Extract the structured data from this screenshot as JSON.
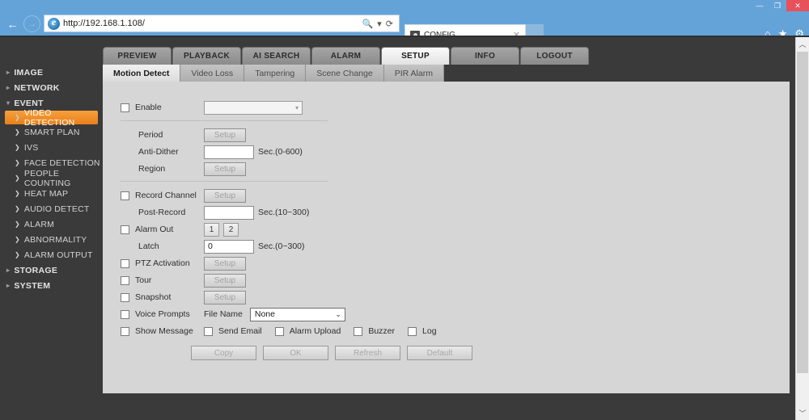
{
  "window": {
    "minimize_label": "—",
    "restore_label": "❐",
    "close_label": "✕"
  },
  "browser": {
    "back_icon": "←",
    "forward_icon": "→",
    "url": "http://192.168.1.108/",
    "search_icon": "🔍",
    "dropdown_icon": "▾",
    "refresh_icon": "⟳",
    "tab_title": "CONFIG",
    "tab_close": "✕",
    "home_icon": "⌂",
    "favorites_icon": "★",
    "tools_icon": "⚙"
  },
  "topnav": {
    "tabs": [
      {
        "label": "PREVIEW",
        "active": false
      },
      {
        "label": "PLAYBACK",
        "active": false
      },
      {
        "label": "AI SEARCH",
        "active": false
      },
      {
        "label": "ALARM",
        "active": false
      },
      {
        "label": "SETUP",
        "active": true
      },
      {
        "label": "INFO",
        "active": false
      },
      {
        "label": "LOGOUT",
        "active": false
      }
    ]
  },
  "subtabs": [
    {
      "label": "Motion Detect",
      "active": true
    },
    {
      "label": "Video Loss",
      "active": false
    },
    {
      "label": "Tampering",
      "active": false
    },
    {
      "label": "Scene Change",
      "active": false
    },
    {
      "label": "PIR Alarm",
      "active": false
    }
  ],
  "sidebar": {
    "items": [
      {
        "label": "IMAGE",
        "type": "group",
        "arrow": "▸"
      },
      {
        "label": "NETWORK",
        "type": "group",
        "arrow": "▸"
      },
      {
        "label": "EVENT",
        "type": "group",
        "arrow": "▾"
      },
      {
        "label": "VIDEO DETECTION",
        "type": "child",
        "arrow": "❯",
        "selected": true
      },
      {
        "label": "SMART PLAN",
        "type": "child",
        "arrow": "❯"
      },
      {
        "label": "IVS",
        "type": "child",
        "arrow": "❯"
      },
      {
        "label": "FACE DETECTION",
        "type": "child",
        "arrow": "❯"
      },
      {
        "label": "PEOPLE COUNTING",
        "type": "child",
        "arrow": "❯"
      },
      {
        "label": "HEAT MAP",
        "type": "child",
        "arrow": "❯"
      },
      {
        "label": "AUDIO DETECT",
        "type": "child",
        "arrow": "❯"
      },
      {
        "label": "ALARM",
        "type": "child",
        "arrow": "❯"
      },
      {
        "label": "ABNORMALITY",
        "type": "child",
        "arrow": "❯"
      },
      {
        "label": "ALARM OUTPUT",
        "type": "child",
        "arrow": "❯"
      },
      {
        "label": "STORAGE",
        "type": "group",
        "arrow": "▸"
      },
      {
        "label": "SYSTEM",
        "type": "group",
        "arrow": "▸"
      }
    ]
  },
  "form": {
    "enable_label": "Enable",
    "enable_select_value": "",
    "enable_select_arrow": "▾",
    "period_label": "Period",
    "period_button": "Setup",
    "antidither_label": "Anti-Dither",
    "antidither_value": "",
    "antidither_hint": "Sec.(0-600)",
    "region_label": "Region",
    "region_button": "Setup",
    "record_channel_label": "Record Channel",
    "record_channel_button": "Setup",
    "postrecord_label": "Post-Record",
    "postrecord_value": "",
    "postrecord_hint": "Sec.(10~300)",
    "alarm_out_label": "Alarm Out",
    "alarm_out_channels": [
      "1",
      "2"
    ],
    "latch_label": "Latch",
    "latch_value": "0",
    "latch_hint": "Sec.(0~300)",
    "ptz_label": "PTZ Activation",
    "ptz_button": "Setup",
    "tour_label": "Tour",
    "tour_button": "Setup",
    "snapshot_label": "Snapshot",
    "snapshot_button": "Setup",
    "voice_prompts_label": "Voice Prompts",
    "file_name_label": "File Name",
    "file_name_value": "None",
    "file_name_chevron": "⌄",
    "show_message_label": "Show Message",
    "send_email_label": "Send Email",
    "alarm_upload_label": "Alarm Upload",
    "buzzer_label": "Buzzer",
    "log_label": "Log",
    "buttons": [
      "Copy",
      "OK",
      "Refresh",
      "Default"
    ]
  },
  "scrollbar": {
    "up_arrow": "︿",
    "down_arrow": "﹀"
  },
  "colors": {
    "accent": "#e8801a",
    "chrome": "#64a3d8",
    "panel": "#d6d6d6",
    "sidebar": "#3a3a3a"
  }
}
